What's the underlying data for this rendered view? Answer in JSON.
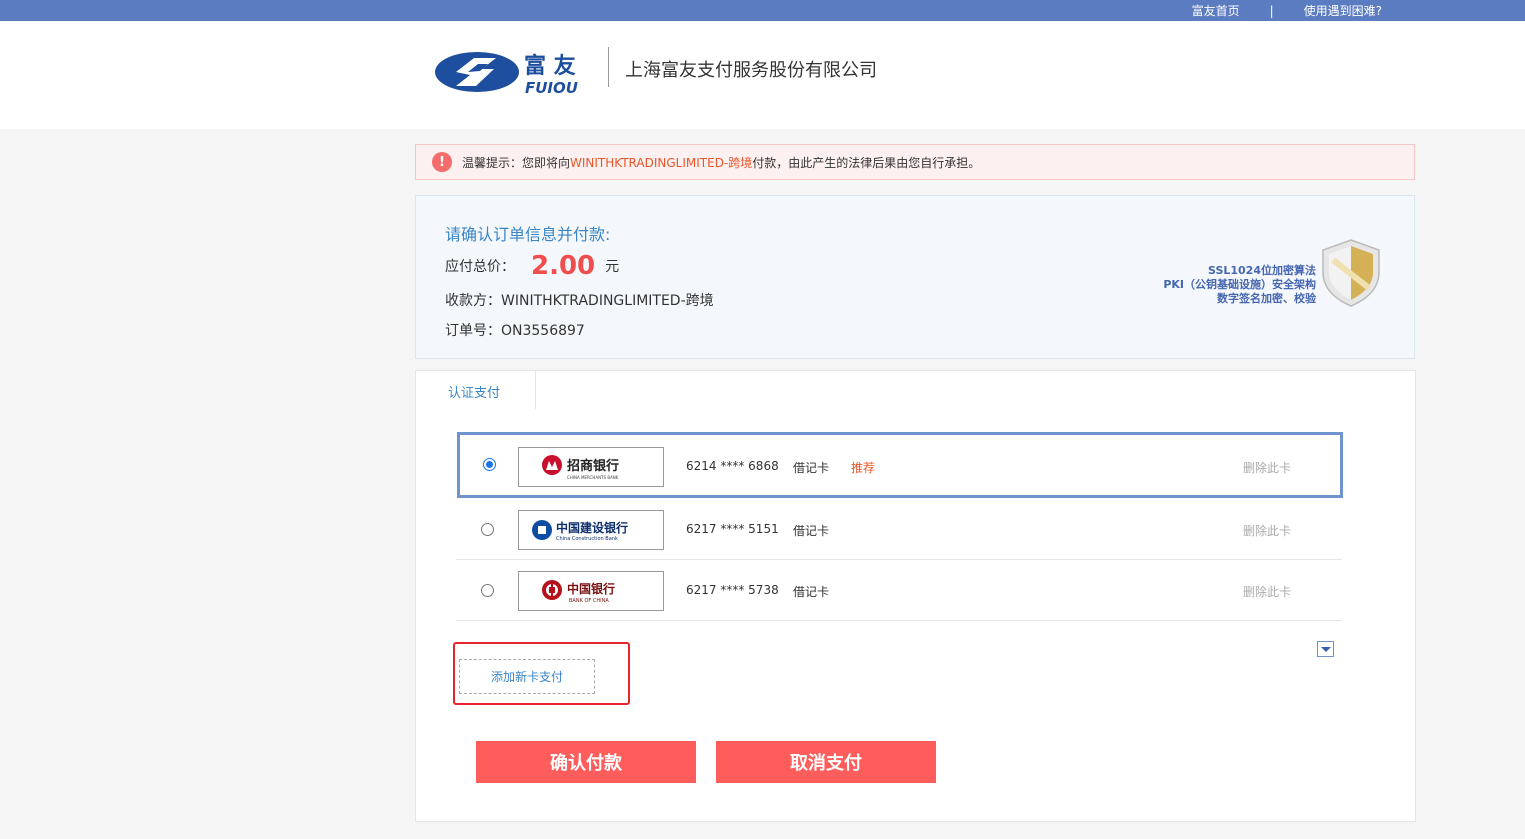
{
  "topbar": {
    "home_link": "富友首页",
    "separator": "|",
    "help_link": "使用遇到困难?"
  },
  "header": {
    "logo_text_cn": "富 友",
    "logo_text_en": "FUIOU",
    "company": "上海富友支付服务股份有限公司"
  },
  "notice": {
    "icon": "!",
    "prefix": "温馨提示：您即将向",
    "merchant": "WINITHKTRADINGLIMITED-跨境",
    "suffix": "付款，由此产生的法律后果由您自行承担。"
  },
  "order": {
    "title": "请确认订单信息并付款:",
    "amount_label": "应付总价：",
    "amount": "2.00",
    "currency": "元",
    "payee_label": "收款方：",
    "payee": "WINITHKTRADINGLIMITED-跨境",
    "order_no_label": "订单号：",
    "order_no": "ON3556897"
  },
  "security": {
    "line1": "SSL1024位加密算法",
    "line2": "PKI（公钥基础设施）安全架构",
    "line3": "数字签名加密、校验"
  },
  "tab": {
    "label": "认证支付"
  },
  "cards": [
    {
      "bank_cn": "招商银行",
      "bank_en": "CHINA MERCHANTS BANK",
      "number": "6214 **** 6868",
      "type": "借记卡",
      "tag": "推荐",
      "delete": "删除此卡",
      "selected": true
    },
    {
      "bank_cn": "中国建设银行",
      "bank_en": "China Construction Bank",
      "number": "6217 **** 5151",
      "type": "借记卡",
      "tag": "",
      "delete": "删除此卡",
      "selected": false
    },
    {
      "bank_cn": "中国银行",
      "bank_en": "BANK OF CHINA",
      "number": "6217 **** 5738",
      "type": "借记卡",
      "tag": "",
      "delete": "删除此卡",
      "selected": false
    }
  ],
  "add_card": "添加新卡支付",
  "buttons": {
    "confirm": "确认付款",
    "cancel": "取消支付"
  },
  "colors": {
    "topbar": "#5b7cc1",
    "accent": "#3a85c6",
    "amount": "#f04d4d",
    "button": "#ff5c5c",
    "highlight_box": "#e8232e"
  }
}
